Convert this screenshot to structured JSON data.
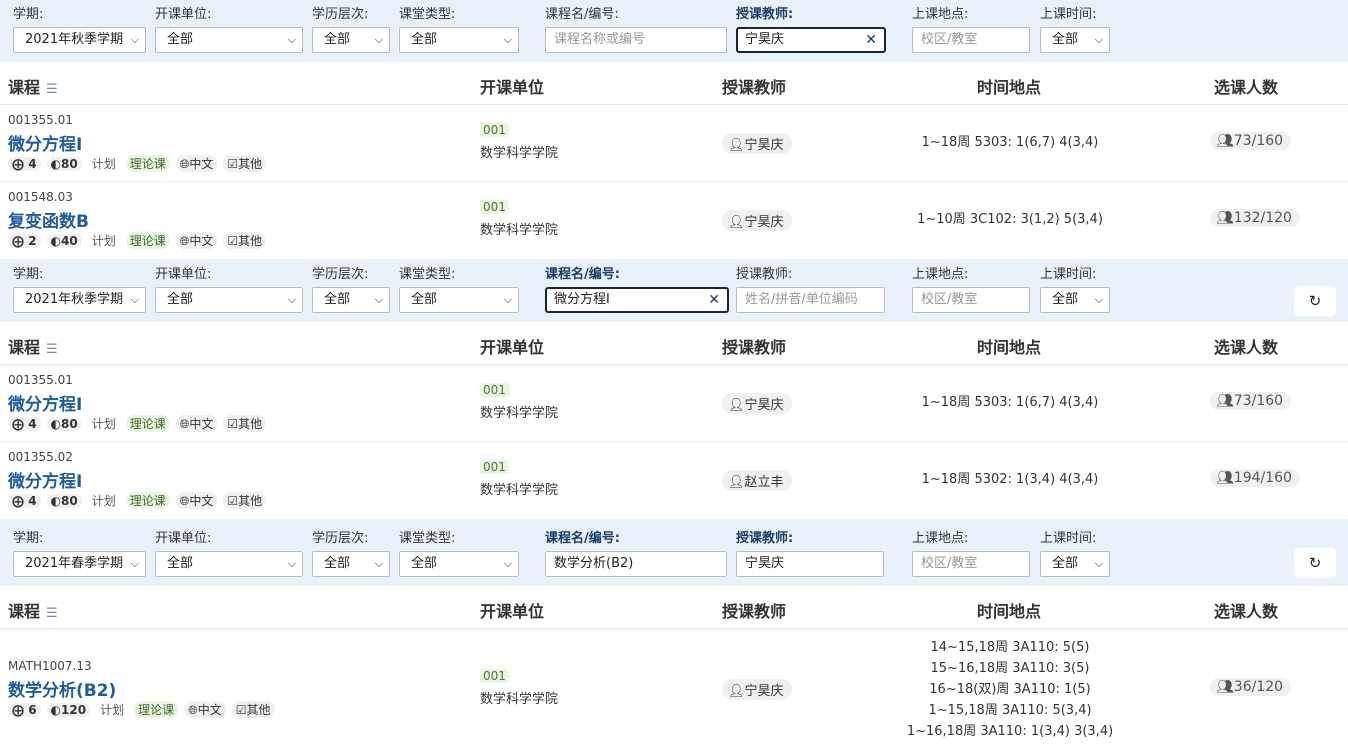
{
  "filter_labels": {
    "term": "学期:",
    "unit": "开课单位:",
    "level": "学历层次:",
    "type": "课堂类型:",
    "course": "课程名/编号:",
    "teacher": "授课教师:",
    "place": "上课地点:",
    "time": "上课时间:"
  },
  "headers": {
    "course": "课程",
    "unit": "开课单位",
    "teacher": "授课教师",
    "time_place": "时间地点",
    "enroll": "选课人数"
  },
  "sections": [
    {
      "filter": {
        "term": "2021年秋季学期",
        "unit": "全部",
        "level": "全部",
        "type": "全部",
        "course_placeholder": "课程名称或编号",
        "course_value": "",
        "teacher_value": "宁昊庆",
        "place_placeholder": "校区/教室",
        "time": "全部"
      },
      "rows": [
        {
          "code": "001355.01",
          "name": "微分方程I",
          "credit": "4",
          "hours": "80",
          "plan": "计划",
          "type": "理论课",
          "lang": "中文",
          "other": "其他",
          "unit_code": "001",
          "unit_name": "数学科学学院",
          "teacher": "宁昊庆",
          "times": [
            "1~18周 5303: 1(6,7) 4(3,4)"
          ],
          "enroll": "73/160"
        },
        {
          "code": "001548.03",
          "name": "复变函数B",
          "credit": "2",
          "hours": "40",
          "plan": "计划",
          "type": "理论课",
          "lang": "中文",
          "other": "其他",
          "unit_code": "001",
          "unit_name": "数学科学学院",
          "teacher": "宁昊庆",
          "times": [
            "1~10周 3C102: 3(1,2) 5(3,4)"
          ],
          "enroll": "132/120"
        }
      ]
    },
    {
      "filter": {
        "term": "2021年秋季学期",
        "unit": "全部",
        "level": "全部",
        "type": "全部",
        "course_value": "微分方程I",
        "teacher_placeholder": "姓名/拼音/单位编码",
        "place_placeholder": "校区/教室",
        "time": "全部"
      },
      "rows": [
        {
          "code": "001355.01",
          "name": "微分方程I",
          "credit": "4",
          "hours": "80",
          "plan": "计划",
          "type": "理论课",
          "lang": "中文",
          "other": "其他",
          "unit_code": "001",
          "unit_name": "数学科学学院",
          "teacher": "宁昊庆",
          "times": [
            "1~18周 5303: 1(6,7) 4(3,4)"
          ],
          "enroll": "73/160"
        },
        {
          "code": "001355.02",
          "name": "微分方程I",
          "credit": "4",
          "hours": "80",
          "plan": "计划",
          "type": "理论课",
          "lang": "中文",
          "other": "其他",
          "unit_code": "001",
          "unit_name": "数学科学学院",
          "teacher": "赵立丰",
          "times": [
            "1~18周 5302: 1(3,4) 4(3,4)"
          ],
          "enroll": "194/160"
        }
      ]
    },
    {
      "filter": {
        "term": "2021年春季学期",
        "unit": "全部",
        "level": "全部",
        "type": "全部",
        "course_value": "数学分析(B2)",
        "teacher_value": "宁昊庆",
        "place_placeholder": "校区/教室",
        "time": "全部"
      },
      "rows": [
        {
          "code": "MATH1007.13",
          "name": "数学分析(B2)",
          "credit": "6",
          "hours": "120",
          "plan": "计划",
          "type": "理论课",
          "lang": "中文",
          "other": "其他",
          "unit_code": "001",
          "unit_name": "数学科学学院",
          "teacher": "宁昊庆",
          "times": [
            "14~15,18周 3A110: 5(5)",
            "15~16,18周 3A110: 3(5)",
            "16~18(双)周 3A110: 1(5)",
            "1~15,18周 3A110: 5(3,4)",
            "1~16,18周 3A110: 1(3,4) 3(3,4)"
          ],
          "enroll": "36/120"
        }
      ]
    }
  ],
  "icons": {
    "credit": "plus-circle",
    "hours": "half-circle",
    "lang": "globe",
    "other": "check-square",
    "teacher": "person",
    "enroll": "people",
    "reset": "refresh",
    "sort": "sort-lines"
  },
  "colors": {
    "filter_bg": "#e9f1fa",
    "link": "#1f5c9e",
    "type_tag_bg": "#e8f6e2"
  }
}
